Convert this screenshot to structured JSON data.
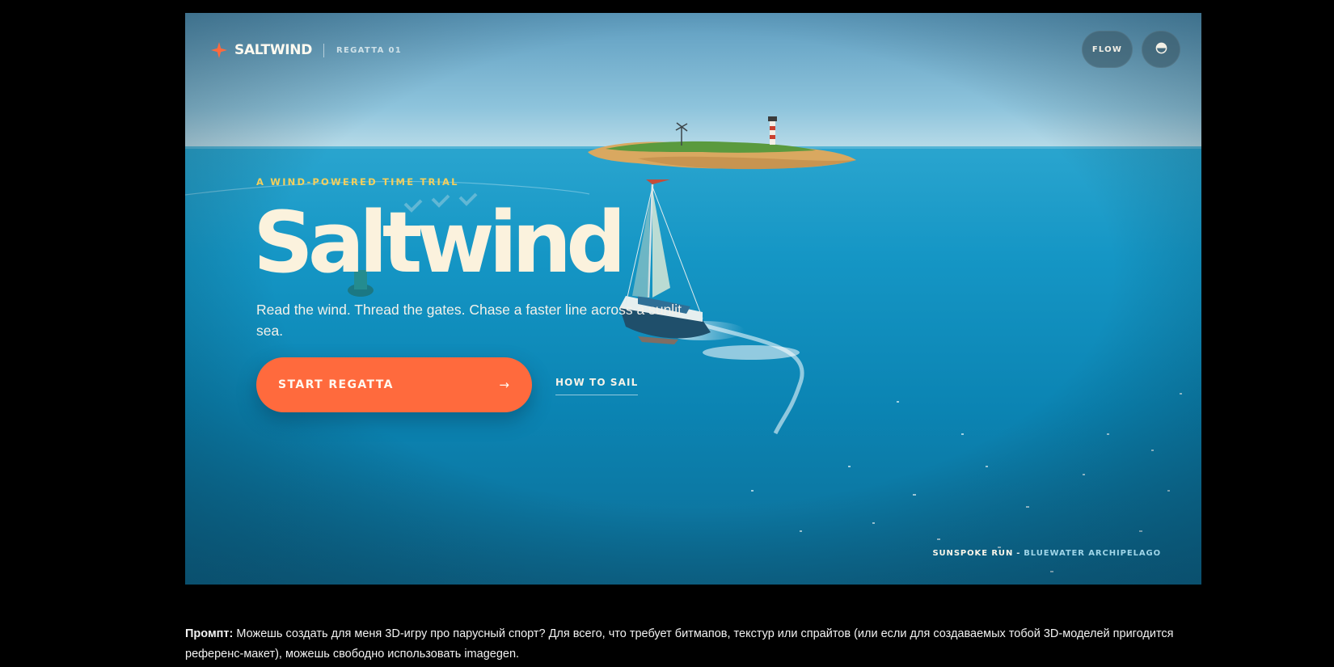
{
  "game": {
    "brand_name": "SALTWIND",
    "brand_sub": "REGATTA 01",
    "flow_label": "FLOW",
    "theme_icon": "half-circle-icon",
    "eyebrow": "A WIND-POWERED TIME TRIAL",
    "title": "Saltwind",
    "tagline": "Read the wind. Thread the gates. Chase a faster line across a sunlit sea.",
    "cta_label": "START REGATTA",
    "cta_arrow": "→",
    "secondary_link": "HOW TO SAIL",
    "location_name": "SUNSPOKE RUN",
    "location_sep": "-",
    "location_region": "BLUEWATER ARCHIPELAGO",
    "colors": {
      "accent": "#ff6a3d",
      "eyebrow": "#f4cf5c",
      "title": "#fbf2dd",
      "sea": "#0a86b4",
      "sky": "#8cc3dc"
    }
  },
  "caption": {
    "label": "Промпт:",
    "text": "Можешь создать для меня 3D-игру про парусный спорт? Для всего, что требует битмапов, текстур или спрайтов (или если для создаваемых тобой 3D-моделей пригодится референс-макет), можешь свободно использовать imagegen."
  }
}
